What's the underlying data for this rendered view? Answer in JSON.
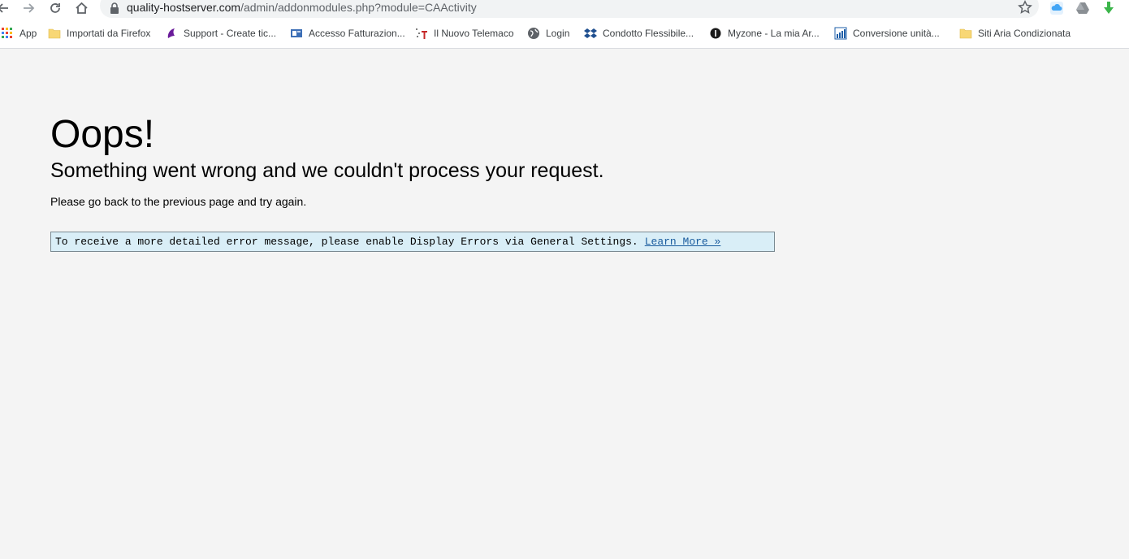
{
  "browser": {
    "url_host": "quality-hostserver.com",
    "url_path": "/admin/addonmodules.php?module=CAActivity"
  },
  "bookmarks": [
    {
      "label": "App",
      "icon": "apps-grid-icon"
    },
    {
      "label": "Importati da Firefox",
      "icon": "folder-icon"
    },
    {
      "label": "Support - Create tic...",
      "icon": "support-logo-icon"
    },
    {
      "label": "Accesso Fatturazion...",
      "icon": "billing-logo-icon"
    },
    {
      "label": "Il Nuovo Telemaco",
      "icon": "telemaco-logo-icon"
    },
    {
      "label": "Login",
      "icon": "globe-icon"
    },
    {
      "label": "Condotto Flessibile...",
      "icon": "dropbox-logo-icon"
    },
    {
      "label": "Myzone - La mia Ar...",
      "icon": "myzone-logo-icon"
    },
    {
      "label": "Conversione unità...",
      "icon": "chart-logo-icon"
    },
    {
      "label": "Siti Aria Condizionata",
      "icon": "folder-icon"
    }
  ],
  "page": {
    "heading": "Oops!",
    "subtitle": "Something went wrong and we couldn't process your request.",
    "message": "Please go back to the previous page and try again.",
    "error_note": "To receive a more detailed error message, please enable Display Errors via General Settings.",
    "learn_more": "Learn More »"
  },
  "colors": {
    "background": "#f4f4f4",
    "error_box_bg": "#d9eef7",
    "link": "#1a5c9e"
  }
}
